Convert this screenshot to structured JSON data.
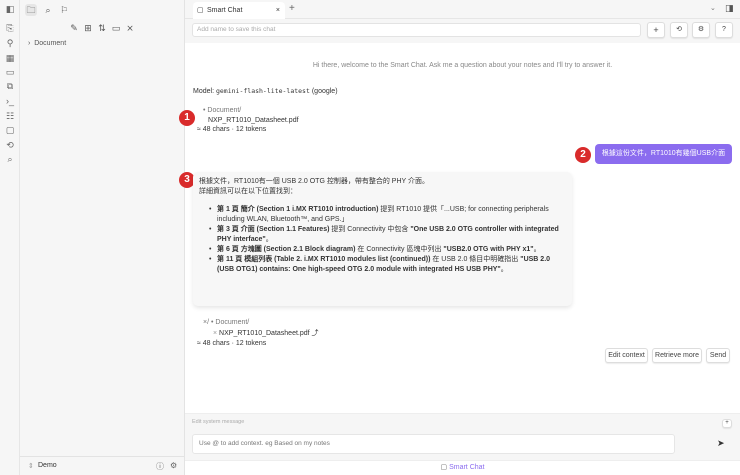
{
  "sidebar": {
    "tree_item": "Document",
    "vault": "Demo"
  },
  "tab": {
    "label": "Smart Chat"
  },
  "chat": {
    "name_placeholder": "Add name to save this chat",
    "welcome": "Hi there, welcome to the Smart Chat. Ask me a question about your notes and I'll try to answer it.",
    "model_label": "Model:",
    "model_name": "gemini-flash-lite-latest",
    "model_provider": "(google)",
    "context1": {
      "folder": "Document/",
      "file": "NXP_RT1010_Datasheet.pdf",
      "stats": "≈ 48 chars · 12 tokens"
    },
    "user_message": "根據這份文件，RT1010有幾個USB介面",
    "assistant": {
      "intro1": "根據文件，RT1010有一個 USB 2.0 OTG 控制器，帶有整合的 PHY 介面。",
      "intro2": "詳細資訊可以在以下位置找到：",
      "items": [
        {
          "b1": "第 1 頁 簡介 (Section 1 i.MX RT1010 introduction)",
          "t1": " 提到 RT1010 提供「...USB; for connecting peripherals including WLAN, Bluetooth™, and GPS.」"
        },
        {
          "b1": "第 3 頁 介面 (Section 1.1 Features)",
          "t1": " 提到 Connectivity 中包含 ",
          "b2": "\"One USB 2.0 OTG controller with integrated PHY interface\"",
          "t2": "。"
        },
        {
          "b1": "第 6 頁 方塊圖 (Section 2.1 Block diagram)",
          "t1": " 在 Connectivity 區塊中列出 ",
          "b2": "\"USB2.0 OTG with PHY x1\"",
          "t2": "。"
        },
        {
          "b1": "第 11 頁 模組列表 (Table 2. i.MX RT1010 modules list (continued))",
          "t1": " 在 USB 2.0 條目中明確指出 ",
          "b2": "\"USB 2.0 (USB OTG1) contains: One high-speed OTG 2.0 module with integrated HS USB PHY\"",
          "t2": "。"
        }
      ]
    },
    "context2": {
      "prefix": "×/",
      "folder": "Document/",
      "file": "NXP_RT1010_Datasheet.pdf",
      "stats": "≈ 48 chars · 12 tokens"
    },
    "buttons": {
      "edit_context": "Edit context",
      "retrieve_more": "Retrieve more",
      "send": "Send"
    },
    "system_placeholder": "Edit system message",
    "input_placeholder": "Use @ to add context. eg Based on my notes",
    "footer": "Smart Chat",
    "badges": [
      "1",
      "2",
      "3"
    ]
  },
  "colors": {
    "accent": "#8b6cef",
    "badge": "#d92b2b"
  }
}
